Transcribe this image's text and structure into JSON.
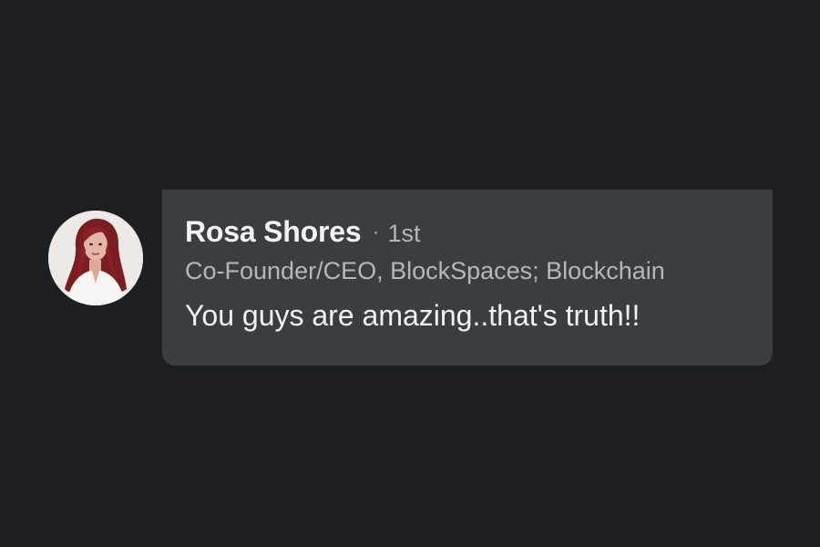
{
  "comment": {
    "author_name": "Rosa Shores",
    "separator": "·",
    "connection_degree": "1st",
    "headline": "Co-Founder/CEO, BlockSpaces; Blockchain",
    "text": "You guys are amazing..that's truth!!"
  },
  "colors": {
    "background": "#1d1f23",
    "bubble": "#3a3d42",
    "primary_text": "#f2f2f2",
    "secondary_text": "#b4b7bc"
  }
}
